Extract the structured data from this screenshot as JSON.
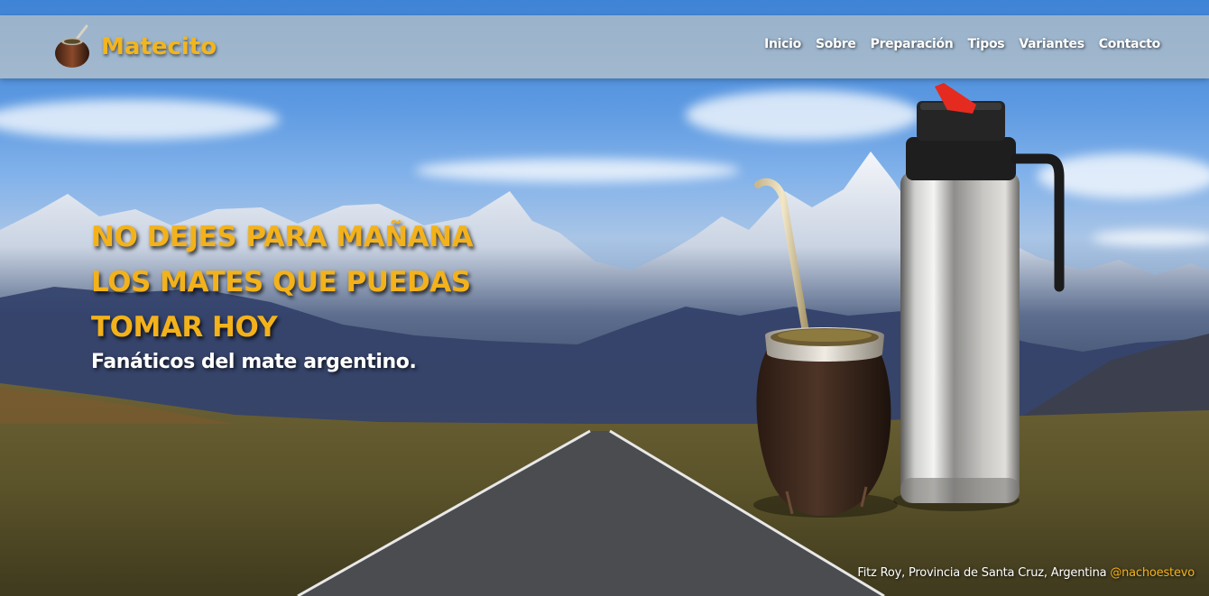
{
  "brand": {
    "name": "Matecito",
    "logo_icon": "mate-gourd-icon"
  },
  "nav": {
    "items": [
      {
        "label": "Inicio"
      },
      {
        "label": "Sobre"
      },
      {
        "label": "Preparación"
      },
      {
        "label": "Tipos"
      },
      {
        "label": "Variantes"
      },
      {
        "label": "Contacto"
      }
    ]
  },
  "hero": {
    "headline_lines": [
      "NO DEJES PARA MAÑANA",
      "LOS MATES QUE PUEDAS",
      "TOMAR HOY"
    ],
    "subtitle": "Fanáticos del mate argentino.",
    "photo_credit": {
      "location": "Fitz Roy, Provincia de Santa Cruz, Argentina",
      "author": "@nachoestevo"
    },
    "products": [
      "mate-gourd-with-bombilla",
      "thermos"
    ]
  },
  "colors": {
    "accent": "#f3b21b",
    "text_light": "#ffffff",
    "navbar_bg": "rgba(208,206,196,0.62)"
  }
}
